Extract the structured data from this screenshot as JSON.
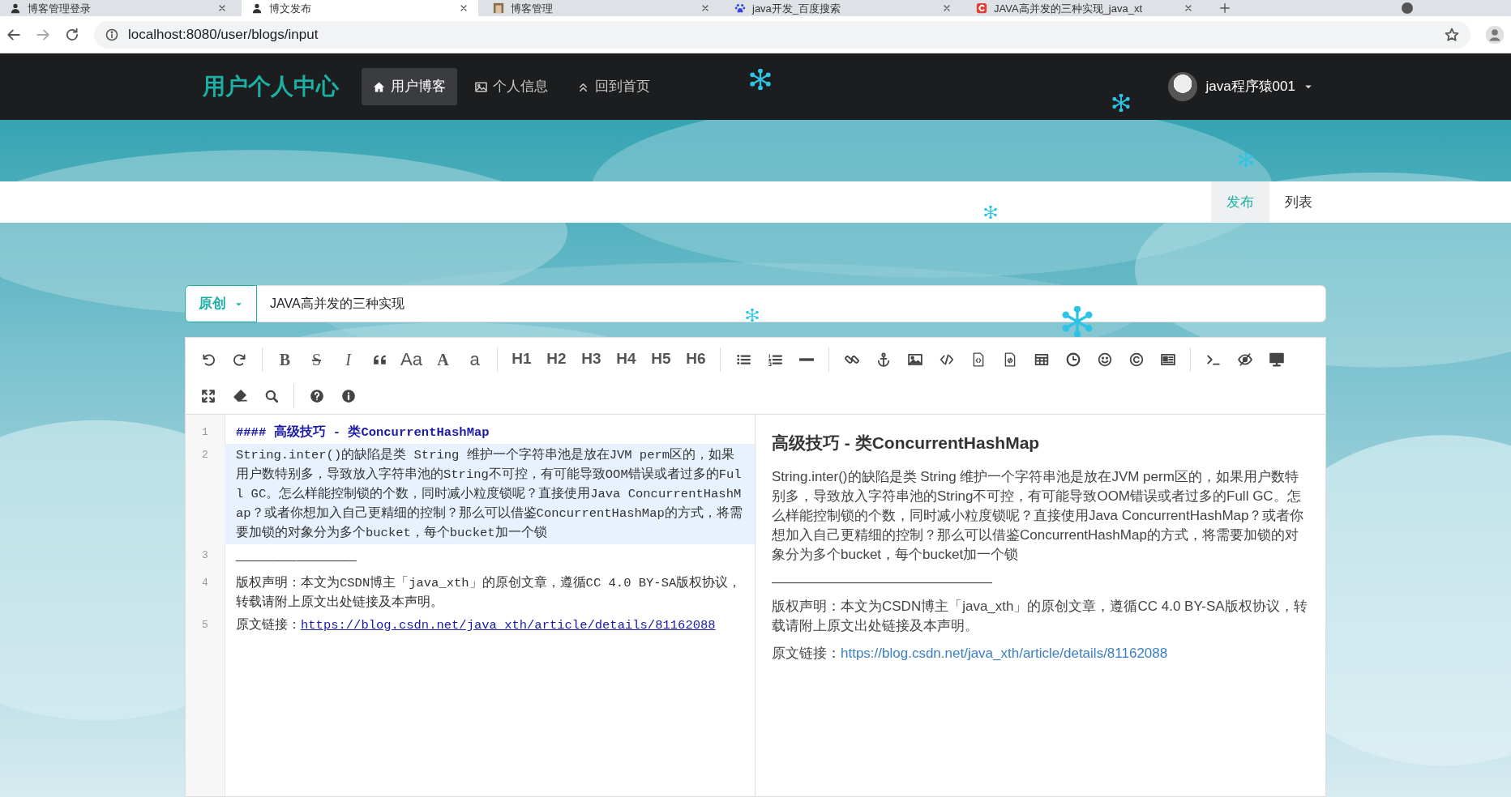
{
  "browser": {
    "tabs": [
      {
        "title": "博客管理登录",
        "selected": false
      },
      {
        "title": "博文发布",
        "selected": true
      },
      {
        "title": "博客管理",
        "selected": false
      },
      {
        "title": "java开发_百度搜索",
        "selected": false
      },
      {
        "title": "JAVA高并发的三种实现_java_xt",
        "selected": false
      }
    ],
    "url": "localhost:8080/user/blogs/input"
  },
  "navbar": {
    "brand": "用户个人中心",
    "items": [
      {
        "label": "用户博客",
        "selected": true
      },
      {
        "label": "个人信息",
        "selected": false
      },
      {
        "label": "回到首页",
        "selected": false
      }
    ],
    "user": "java程序猿001"
  },
  "subnav": {
    "tabs": [
      {
        "label": "发布",
        "selected": true
      },
      {
        "label": "列表",
        "selected": false
      }
    ]
  },
  "title_row": {
    "type_button": "原创",
    "title": "JAVA高并发的三种实现"
  },
  "toolbar": {
    "rows": [
      [
        [
          {
            "kind": "icon"
          },
          {
            "kind": "icon"
          }
        ],
        [
          {
            "kind": "bold",
            "label": "B"
          },
          {
            "kind": "strike",
            "label": "S"
          },
          {
            "kind": "italic",
            "label": "I"
          },
          {
            "kind": "icon"
          },
          {
            "kind": "text",
            "label": "Aa"
          },
          {
            "kind": "serif",
            "label": "A"
          },
          {
            "kind": "text",
            "label": "a"
          }
        ],
        [
          {
            "kind": "heading",
            "label": "H1"
          },
          {
            "kind": "heading",
            "label": "H2"
          },
          {
            "kind": "heading",
            "label": "H3"
          },
          {
            "kind": "heading",
            "label": "H4"
          },
          {
            "kind": "heading",
            "label": "H5"
          },
          {
            "kind": "heading",
            "label": "H6"
          }
        ],
        [
          {
            "kind": "icon"
          },
          {
            "kind": "icon"
          },
          {
            "kind": "icon"
          }
        ],
        [
          {
            "kind": "icon"
          },
          {
            "kind": "icon"
          },
          {
            "kind": "icon"
          },
          {
            "kind": "icon"
          },
          {
            "kind": "icon"
          },
          {
            "kind": "icon"
          },
          {
            "kind": "icon"
          },
          {
            "kind": "icon"
          },
          {
            "kind": "icon"
          },
          {
            "kind": "icon"
          },
          {
            "kind": "icon"
          }
        ],
        [
          {
            "kind": "icon"
          },
          {
            "kind": "icon"
          },
          {
            "kind": "icon"
          }
        ]
      ],
      [
        [
          {
            "kind": "icon"
          },
          {
            "kind": "icon"
          },
          {
            "kind": "icon"
          }
        ],
        [
          {
            "kind": "icon"
          },
          {
            "kind": "icon"
          }
        ]
      ]
    ]
  },
  "editor": {
    "lines": [
      {
        "number": "1",
        "kind": "heading",
        "active": false,
        "text": "#### 高级技巧 - 类ConcurrentHashMap"
      },
      {
        "number": "2",
        "kind": "text",
        "active": true,
        "text": "String.inter()的缺陷是类 String 维护一个字符串池是放在JVM perm区的，如果用户数特别多，导致放入字符串池的String不可控，有可能导致OOM错误或者过多的Full GC。怎么样能控制锁的个数，同时减小粒度锁呢？直接使用Java ConcurrentHashMap？或者你想加入自己更精细的控制？那么可以借鉴ConcurrentHashMap的方式，将需要加锁的对象分为多个bucket，每个bucket加一个锁"
      },
      {
        "number": "3",
        "kind": "text",
        "active": false,
        "text": "————————————————"
      },
      {
        "number": "4",
        "kind": "text",
        "active": false,
        "text": "版权声明：本文为CSDN博主「java_xth」的原创文章，遵循CC 4.0 BY-SA版权协议，转载请附上原文出处链接及本声明。"
      },
      {
        "number": "5",
        "kind": "link",
        "active": false,
        "text": "原文链接：",
        "link": "https://blog.csdn.net/java_xth/article/details/81162088"
      }
    ]
  },
  "preview": {
    "blocks": [
      {
        "kind": "heading",
        "text": "高级技巧 - 类ConcurrentHashMap"
      },
      {
        "kind": "paragraph",
        "text": "String.inter()的缺陷是类 String 维护一个字符串池是放在JVM perm区的，如果用户数特别多，导致放入字符串池的String不可控，有可能导致OOM错误或者过多的Full GC。怎么样能控制锁的个数，同时减小粒度锁呢？直接使用Java ConcurrentHashMap？或者你想加入自己更精细的控制？那么可以借鉴ConcurrentHashMap的方式，将需要加锁的对象分为多个bucket，每个bucket加一个锁"
      },
      {
        "kind": "rule",
        "text": "————————————————"
      },
      {
        "kind": "paragraph",
        "text": "版权声明：本文为CSDN博主「java_xth」的原创文章，遵循CC 4.0 BY-SA版权协议，转载请附上原文出处链接及本声明。"
      },
      {
        "kind": "link",
        "text": "原文链接：",
        "link": "https://blog.csdn.net/java_xth/article/details/81162088"
      }
    ]
  }
}
